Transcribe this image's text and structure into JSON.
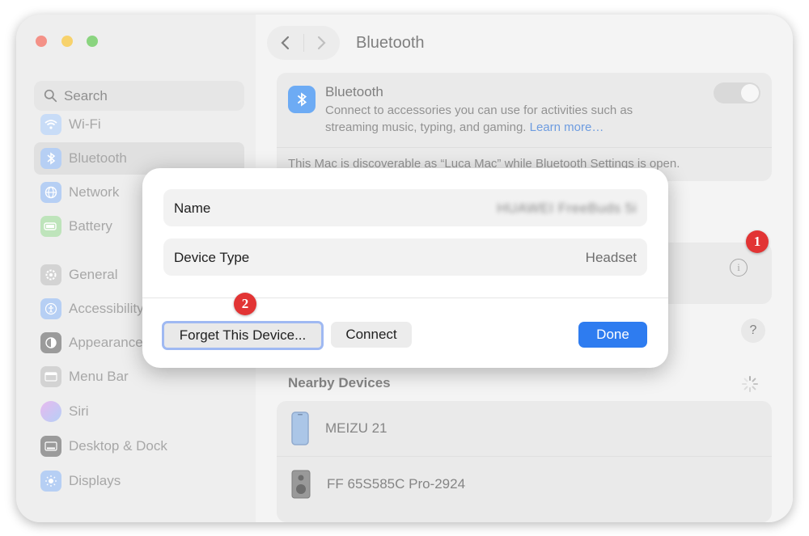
{
  "window": {
    "sidebar": {
      "search_placeholder": "Search",
      "items": [
        {
          "label": "Wi-Fi",
          "icon": "wifi-icon",
          "color": "#4a8ff0"
        },
        {
          "label": "Bluetooth",
          "icon": "bluetooth-icon",
          "color": "#4a8ff0",
          "selected": true
        },
        {
          "label": "Network",
          "icon": "globe-icon",
          "color": "#4a8ff0"
        },
        {
          "label": "Battery",
          "icon": "battery-icon",
          "color": "#59c452"
        },
        {
          "label": "General",
          "icon": "gear-icon",
          "color": "#9a9a9a"
        },
        {
          "label": "Accessibility",
          "icon": "accessibility-icon",
          "color": "#4a8ff0"
        },
        {
          "label": "Appearance",
          "icon": "appearance-icon",
          "color": "#333333"
        },
        {
          "label": "Menu Bar",
          "icon": "menu-bar-icon",
          "color": "#9a9a9a"
        },
        {
          "label": "Siri",
          "icon": "siri-icon",
          "color": "#b35fd4"
        },
        {
          "label": "Desktop & Dock",
          "icon": "dock-icon",
          "color": "#333333"
        },
        {
          "label": "Displays",
          "icon": "sun-icon",
          "color": "#4a8ff0"
        }
      ]
    },
    "main": {
      "title": "Bluetooth",
      "bluetooth_card": {
        "title": "Bluetooth",
        "description": "Connect to accessories you can use for activities such as streaming music, typing, and gaming.",
        "link": "Learn more…",
        "toggle_on": true,
        "discoverable_text": "This Mac is discoverable as “Luca Mac” while Bluetooth Settings is open."
      },
      "nearby": {
        "title": "Nearby Devices",
        "devices": [
          {
            "name": "MEIZU 21",
            "icon": "phone-icon"
          },
          {
            "name": "FF 65S585C Pro-2924",
            "icon": "speaker-icon"
          }
        ]
      },
      "help_label": "?"
    },
    "dialog": {
      "name_label": "Name",
      "name_value": "HUAWEI FreeBuds 5i",
      "type_label": "Device Type",
      "type_value": "Headset",
      "forget_label": "Forget This Device...",
      "connect_label": "Connect",
      "done_label": "Done"
    },
    "annotations": [
      "1",
      "2"
    ]
  },
  "colors": {
    "accent": "#2e7cf0",
    "annotation": "#e23434"
  }
}
